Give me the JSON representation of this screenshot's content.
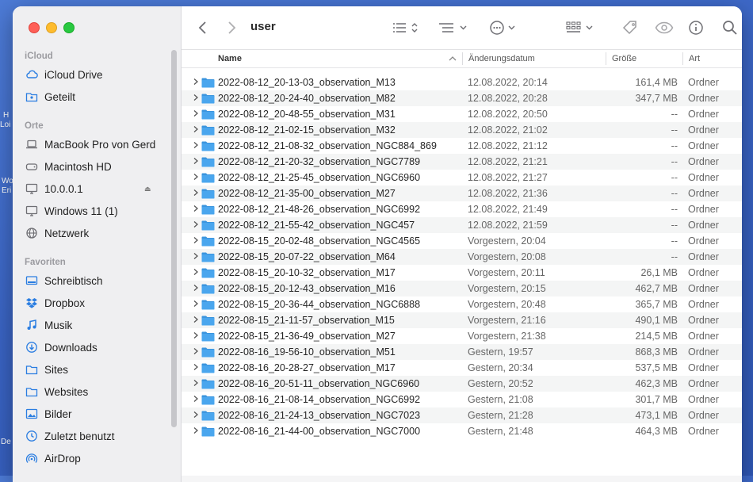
{
  "window": {
    "title": "user"
  },
  "desktop": {
    "labels": [
      "H",
      "Loi",
      "Wo",
      "Eri",
      "De"
    ]
  },
  "sidebar": {
    "sections": [
      {
        "label": "iCloud",
        "items": [
          {
            "label": "iCloud Drive",
            "icon": "cloud-icon"
          },
          {
            "label": "Geteilt",
            "icon": "shared-folder-icon"
          }
        ]
      },
      {
        "label": "Orte",
        "items": [
          {
            "label": "MacBook Pro von Gerd",
            "icon": "laptop-icon"
          },
          {
            "label": "Macintosh HD",
            "icon": "hard-drive-icon"
          },
          {
            "label": "10.0.0.1",
            "icon": "display-icon",
            "eject": true
          },
          {
            "label": "Windows 11 (1)",
            "icon": "display-icon"
          },
          {
            "label": "Netzwerk",
            "icon": "globe-icon"
          }
        ]
      },
      {
        "label": "Favoriten",
        "items": [
          {
            "label": "Schreibtisch",
            "icon": "desktop-icon"
          },
          {
            "label": "Dropbox",
            "icon": "dropbox-icon"
          },
          {
            "label": "Musik",
            "icon": "music-icon"
          },
          {
            "label": "Downloads",
            "icon": "download-icon"
          },
          {
            "label": "Sites",
            "icon": "folder-icon"
          },
          {
            "label": "Websites",
            "icon": "folder-icon"
          },
          {
            "label": "Bilder",
            "icon": "photo-icon"
          },
          {
            "label": "Zuletzt benutzt",
            "icon": "clock-icon"
          },
          {
            "label": "AirDrop",
            "icon": "airdrop-icon"
          }
        ]
      }
    ]
  },
  "columns": {
    "name": "Name",
    "date": "Änderungsdatum",
    "size": "Größe",
    "kind": "Art"
  },
  "files": [
    {
      "name": "2022-08-12_20-13-03_observation_M13",
      "date": "12.08.2022, 20:14",
      "size": "161,4 MB",
      "kind": "Ordner"
    },
    {
      "name": "2022-08-12_20-24-40_observation_M82",
      "date": "12.08.2022, 20:28",
      "size": "347,7 MB",
      "kind": "Ordner"
    },
    {
      "name": "2022-08-12_20-48-55_observation_M31",
      "date": "12.08.2022, 20:50",
      "size": "--",
      "kind": "Ordner"
    },
    {
      "name": "2022-08-12_21-02-15_observation_M32",
      "date": "12.08.2022, 21:02",
      "size": "--",
      "kind": "Ordner"
    },
    {
      "name": "2022-08-12_21-08-32_observation_NGC884_869",
      "date": "12.08.2022, 21:12",
      "size": "--",
      "kind": "Ordner"
    },
    {
      "name": "2022-08-12_21-20-32_observation_NGC7789",
      "date": "12.08.2022, 21:21",
      "size": "--",
      "kind": "Ordner"
    },
    {
      "name": "2022-08-12_21-25-45_observation_NGC6960",
      "date": "12.08.2022, 21:27",
      "size": "--",
      "kind": "Ordner"
    },
    {
      "name": "2022-08-12_21-35-00_observation_M27",
      "date": "12.08.2022, 21:36",
      "size": "--",
      "kind": "Ordner"
    },
    {
      "name": "2022-08-12_21-48-26_observation_NGC6992",
      "date": "12.08.2022, 21:49",
      "size": "--",
      "kind": "Ordner"
    },
    {
      "name": "2022-08-12_21-55-42_observation_NGC457",
      "date": "12.08.2022, 21:59",
      "size": "--",
      "kind": "Ordner"
    },
    {
      "name": "2022-08-15_20-02-48_observation_NGC4565",
      "date": "Vorgestern, 20:04",
      "size": "--",
      "kind": "Ordner"
    },
    {
      "name": "2022-08-15_20-07-22_observation_M64",
      "date": "Vorgestern, 20:08",
      "size": "--",
      "kind": "Ordner"
    },
    {
      "name": "2022-08-15_20-10-32_observation_M17",
      "date": "Vorgestern, 20:11",
      "size": "26,1 MB",
      "kind": "Ordner"
    },
    {
      "name": "2022-08-15_20-12-43_observation_M16",
      "date": "Vorgestern, 20:15",
      "size": "462,7 MB",
      "kind": "Ordner"
    },
    {
      "name": "2022-08-15_20-36-44_observation_NGC6888",
      "date": "Vorgestern, 20:48",
      "size": "365,7 MB",
      "kind": "Ordner"
    },
    {
      "name": "2022-08-15_21-11-57_observation_M15",
      "date": "Vorgestern, 21:16",
      "size": "490,1 MB",
      "kind": "Ordner"
    },
    {
      "name": "2022-08-15_21-36-49_observation_M27",
      "date": "Vorgestern, 21:38",
      "size": "214,5 MB",
      "kind": "Ordner"
    },
    {
      "name": "2022-08-16_19-56-10_observation_M51",
      "date": "Gestern, 19:57",
      "size": "868,3 MB",
      "kind": "Ordner"
    },
    {
      "name": "2022-08-16_20-28-27_observation_M17",
      "date": "Gestern, 20:34",
      "size": "537,5 MB",
      "kind": "Ordner"
    },
    {
      "name": "2022-08-16_20-51-11_observation_NGC6960",
      "date": "Gestern, 20:52",
      "size": "462,3 MB",
      "kind": "Ordner"
    },
    {
      "name": "2022-08-16_21-08-14_observation_NGC6992",
      "date": "Gestern, 21:08",
      "size": "301,7 MB",
      "kind": "Ordner"
    },
    {
      "name": "2022-08-16_21-24-13_observation_NGC7023",
      "date": "Gestern, 21:28",
      "size": "473,1 MB",
      "kind": "Ordner"
    },
    {
      "name": "2022-08-16_21-44-00_observation_NGC7000",
      "date": "Gestern, 21:48",
      "size": "464,3 MB",
      "kind": "Ordner"
    }
  ],
  "colors": {
    "accent": "#2a7de1",
    "folder": "#4aa6ee",
    "folder_tab": "#3b95de"
  }
}
